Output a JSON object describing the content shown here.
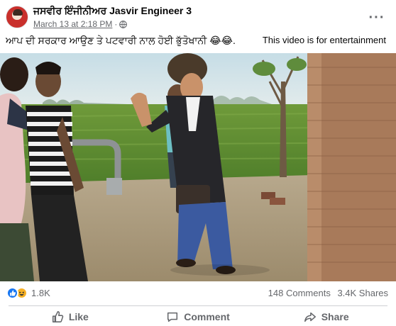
{
  "post": {
    "author": "ਜਸਵੀਰ ਇੰਜੀਨੀਅਰ Jasvir Engineer 3",
    "timestamp": "March 13 at 2:18 PM",
    "separator": "·",
    "audience_icon": "globe-icon",
    "more_icon": "more-options-icon",
    "more_glyph": "···",
    "caption": "ਆਪ ਦੀ ਸਰਕਾਰ ਆਉਣ ਤੇ ਪਟਵਾਰੀ ਨਾਲ ਹੋਈ ਭੁੱਤੋਖਾਨੀ 😂😂.",
    "disclaimer": "This video is for entertainment"
  },
  "video": {
    "content": "outdoor scene: four men near a field, one in a turban and blazer gesturing"
  },
  "stats": {
    "reaction_icons": [
      "like-icon",
      "haha-icon"
    ],
    "reaction_count": "1.8K",
    "comments": "148 Comments",
    "shares": "3.4K Shares"
  },
  "actions": {
    "like": "Like",
    "comment": "Comment",
    "share": "Share"
  },
  "colors": {
    "text_primary": "#050505",
    "text_secondary": "#65676b",
    "like_blue": "#1877f2",
    "haha_yellow": "#f7b125",
    "divider": "#ced0d4"
  }
}
